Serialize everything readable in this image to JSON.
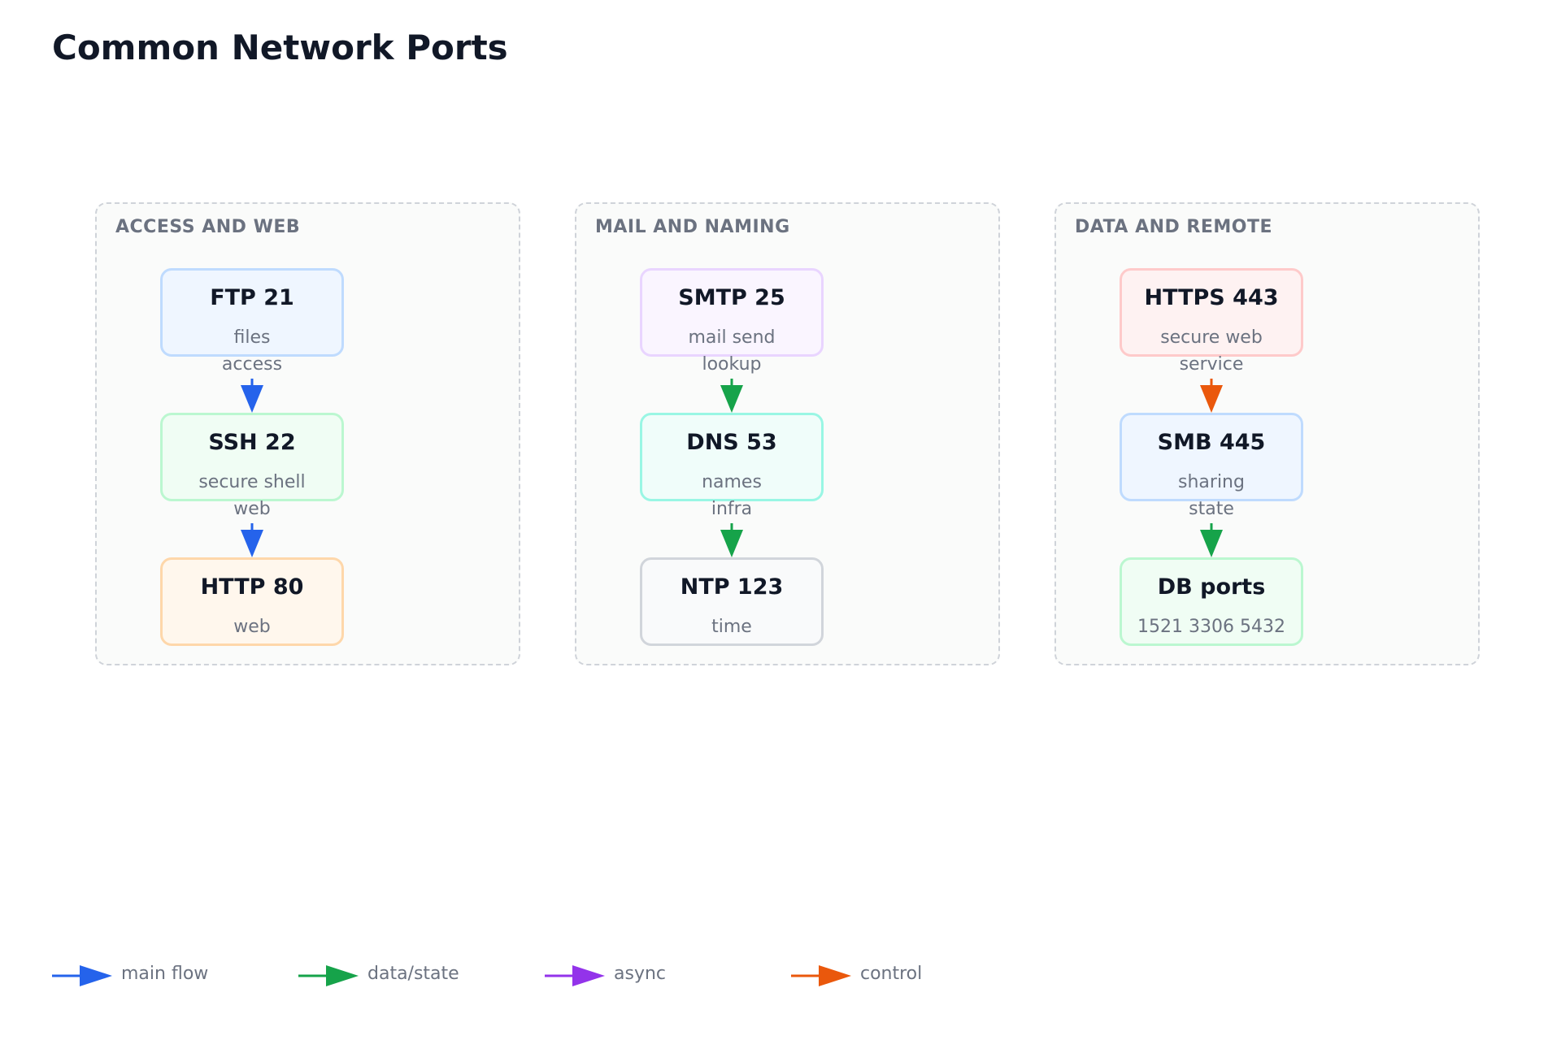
{
  "title": "Common Network Ports",
  "groups": [
    {
      "label": "ACCESS AND WEB",
      "nodes": [
        {
          "title": "FTP 21",
          "sub": "files"
        },
        {
          "title": "SSH 22",
          "sub": "secure shell"
        },
        {
          "title": "HTTP 80",
          "sub": "web"
        }
      ],
      "edges": [
        {
          "label": "access",
          "type": "main flow"
        },
        {
          "label": "web",
          "type": "main flow"
        }
      ]
    },
    {
      "label": "MAIL AND NAMING",
      "nodes": [
        {
          "title": "SMTP 25",
          "sub": "mail send"
        },
        {
          "title": "DNS 53",
          "sub": "names"
        },
        {
          "title": "NTP 123",
          "sub": "time"
        }
      ],
      "edges": [
        {
          "label": "lookup",
          "type": "data/state"
        },
        {
          "label": "infra",
          "type": "data/state"
        }
      ]
    },
    {
      "label": "DATA AND REMOTE",
      "nodes": [
        {
          "title": "HTTPS 443",
          "sub": "secure web"
        },
        {
          "title": "SMB 445",
          "sub": "sharing"
        },
        {
          "title": "DB ports",
          "sub": "1521 3306 5432"
        }
      ],
      "edges": [
        {
          "label": "service",
          "type": "control"
        },
        {
          "label": "state",
          "type": "data/state"
        }
      ]
    }
  ],
  "legend": [
    {
      "label": "main flow",
      "color": "#2563eb"
    },
    {
      "label": "data/state",
      "color": "#16a34a"
    },
    {
      "label": "async",
      "color": "#9333ea"
    },
    {
      "label": "control",
      "color": "#ea580c"
    }
  ],
  "colors": {
    "main_flow": "#2563eb",
    "data_state": "#16a34a",
    "async": "#9333ea",
    "control": "#ea580c"
  }
}
